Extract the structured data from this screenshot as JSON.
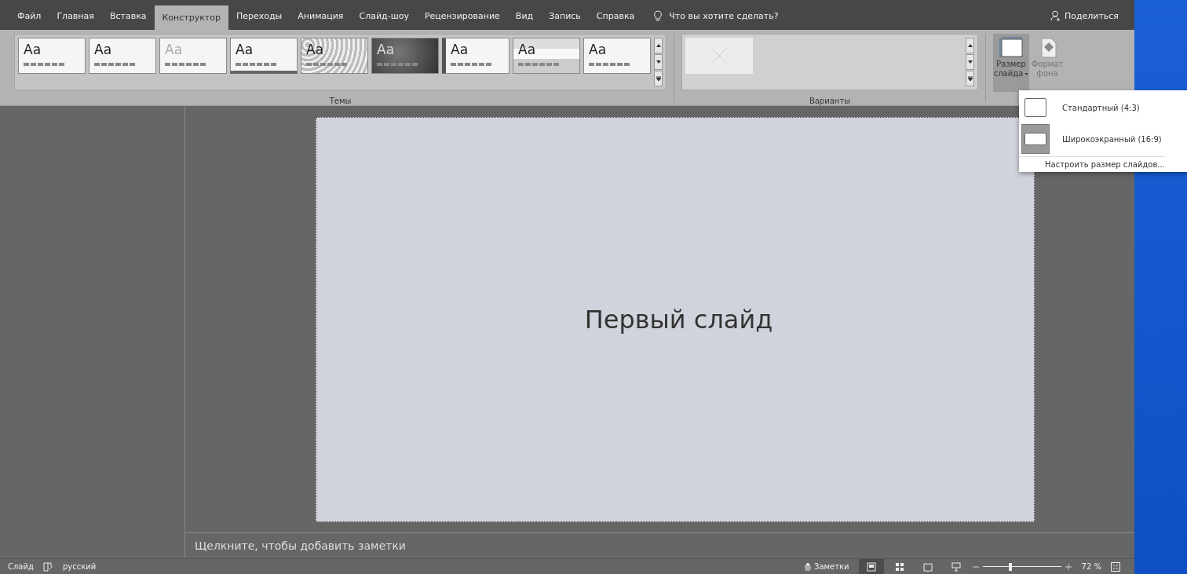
{
  "tabs": [
    {
      "label": "Файл",
      "selected": false
    },
    {
      "label": "Главная",
      "selected": false
    },
    {
      "label": "Вставка",
      "selected": false
    },
    {
      "label": "Конструктор",
      "selected": true
    },
    {
      "label": "Переходы",
      "selected": false
    },
    {
      "label": "Анимация",
      "selected": false
    },
    {
      "label": "Слайд-шоу",
      "selected": false
    },
    {
      "label": "Рецензирование",
      "selected": false
    },
    {
      "label": "Вид",
      "selected": false
    },
    {
      "label": "Запись",
      "selected": false
    },
    {
      "label": "Справка",
      "selected": false
    }
  ],
  "tell_me": {
    "placeholder": "Что вы хотите сделать?"
  },
  "share_button": "Поделиться",
  "themes": {
    "label": "Темы",
    "items": [
      {
        "kind": "plain",
        "text": "Aa"
      },
      {
        "kind": "plain",
        "text": "Aa"
      },
      {
        "kind": "faded",
        "text": "Aa"
      },
      {
        "kind": "lined",
        "text": "Aa"
      },
      {
        "kind": "pattern",
        "text": "Aa"
      },
      {
        "kind": "dark",
        "text": "Aa"
      },
      {
        "kind": "accent",
        "text": "Aa"
      },
      {
        "kind": "banded",
        "text": "Aa"
      },
      {
        "kind": "plain",
        "text": "Aa"
      }
    ]
  },
  "variants": {
    "label": "Варианты"
  },
  "slide_size_button": {
    "label_1": "Размер",
    "label_2": "слайда",
    "selected": true
  },
  "format_background_button": {
    "label_1": "Формат",
    "label_2": "фона",
    "disabled": true
  },
  "slide_size_menu": {
    "items": [
      {
        "label": "Стандартный (4:3)",
        "selected": false
      },
      {
        "label": "Широкоэкранный (16:9)",
        "selected": true
      }
    ],
    "custom_link": "Настроить размер слайдов..."
  },
  "slide": {
    "title": "Первый слайд"
  },
  "notes": {
    "placeholder": "Щелкните, чтобы добавить заметки"
  },
  "status_bar": {
    "slide": "Слайд",
    "language": "русский",
    "notes_button": "Заметки",
    "views": [
      {
        "kind": "normal",
        "selected": true
      },
      {
        "kind": "sorter",
        "selected": false
      },
      {
        "kind": "reading",
        "selected": false
      },
      {
        "kind": "show",
        "selected": false
      }
    ],
    "zoom": {
      "level": 0.35,
      "reading": "72 %"
    }
  }
}
